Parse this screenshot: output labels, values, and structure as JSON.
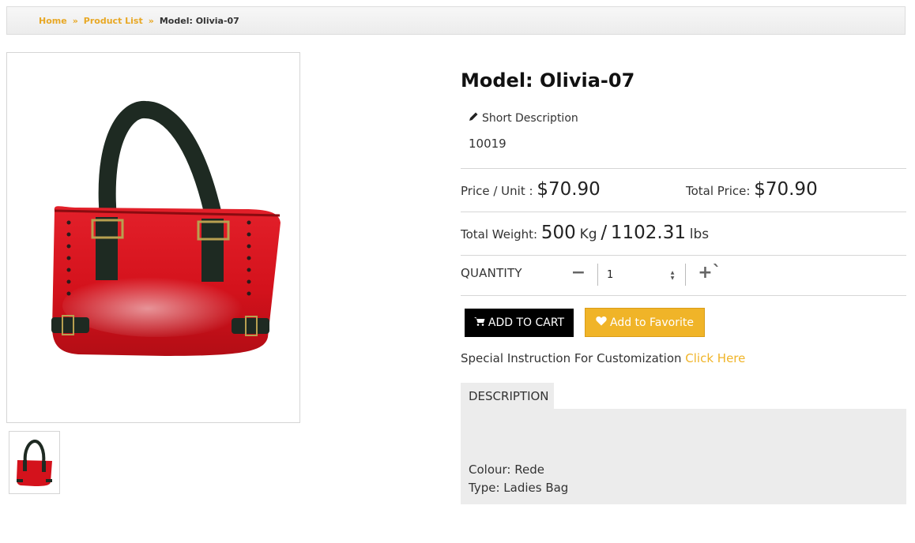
{
  "breadcrumb": {
    "home": "Home",
    "separator": "»",
    "product_list": "Product List",
    "current": "Model: Olivia-07"
  },
  "product": {
    "title": "Model: Olivia-07",
    "short_description_label": "Short Description",
    "short_description_value": "10019",
    "main_image_alt": "red handbag with black leather straps",
    "thumbnail_alt": "red handbag thumbnail"
  },
  "pricing": {
    "unit_label": "Price / Unit : ",
    "unit_price": "$70.90",
    "total_label": "Total Price: ",
    "total_price": "$70.90"
  },
  "weight": {
    "label": "Total Weight: ",
    "kg_value": "500",
    "kg_unit": "Kg",
    "slash": "/",
    "lbs_value": "1102.31",
    "lbs_unit": "lbs"
  },
  "quantity": {
    "label": "QUANTITY",
    "minus": "−",
    "value": "1",
    "plus": "+`"
  },
  "actions": {
    "add_to_cart": "ADD TO CART",
    "add_to_favorite": "Add to Favorite"
  },
  "customization": {
    "text": "Special Instruction For Customization ",
    "link": "Click Here"
  },
  "description": {
    "tab_label": "DESCRIPTION",
    "colour": "Colour: Rede",
    "type": "Type: Ladies Bag"
  },
  "colors": {
    "accent": "#f0b428",
    "breadcrumb_link": "#e8a825",
    "cart_button": "#000000",
    "panel_bg": "#ececec"
  },
  "icons": {
    "edit": "pencil-icon",
    "cart": "cart-icon",
    "favorite": "heart-icon"
  }
}
